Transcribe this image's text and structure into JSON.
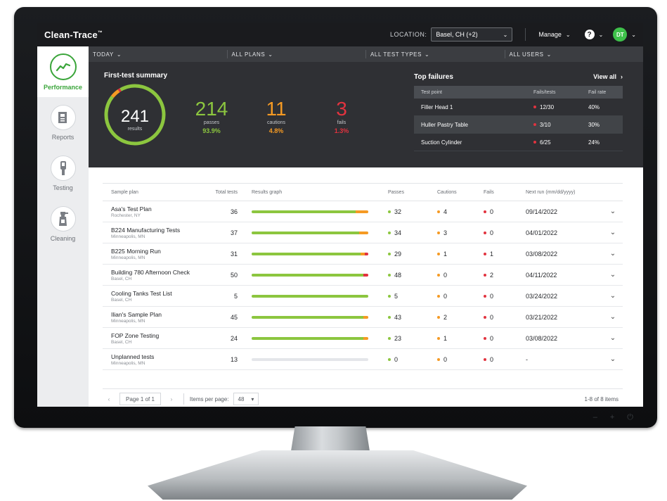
{
  "app": {
    "brand": "Clean-Trace",
    "brand_mark": "™"
  },
  "topbar": {
    "location_label": "LOCATION:",
    "location_value": "Basel, CH (+2)",
    "manage_label": "Manage",
    "help_glyph": "?",
    "user_initials": "DT"
  },
  "sidebar": {
    "items": [
      {
        "label": "Performance",
        "icon": "performance-chart-icon",
        "active": true
      },
      {
        "label": "Reports",
        "icon": "reports-icon",
        "active": false
      },
      {
        "label": "Testing",
        "icon": "luminometer-icon",
        "active": false
      },
      {
        "label": "Cleaning",
        "icon": "spray-bottle-icon",
        "active": false
      }
    ]
  },
  "filters": [
    "TODAY",
    "ALL PLANS",
    "ALL TEST TYPES",
    "ALL USERS"
  ],
  "summary": {
    "title": "First-test summary",
    "results_total": "241",
    "results_label": "results",
    "passes": {
      "value": "214",
      "label": "passes",
      "pct": "93.9%"
    },
    "cautions": {
      "value": "11",
      "label": "cautions",
      "pct": "4.8%"
    },
    "fails": {
      "value": "3",
      "label": "fails",
      "pct": "1.3%"
    },
    "ring_fractions": {
      "pass": 0.939,
      "caution": 0.048,
      "fail": 0.013
    }
  },
  "top_failures": {
    "title": "Top failures",
    "view_all": "View all",
    "headers": [
      "Test point",
      "Fails/tests",
      "Fail rate"
    ],
    "rows": [
      {
        "point": "Filler Head 1",
        "ratio": "12/30",
        "rate": "40%"
      },
      {
        "point": "Huller Pastry Table",
        "ratio": "3/10",
        "rate": "30%"
      },
      {
        "point": "Suction Cylinder",
        "ratio": "6/25",
        "rate": "24%"
      }
    ]
  },
  "table": {
    "headers": [
      "Sample plan",
      "Total tests",
      "Results graph",
      "Passes",
      "Cautions",
      "Fails",
      "Next run (mm/dd/yyyy)"
    ],
    "rows": [
      {
        "name": "Asa's Test Plan",
        "loc": "Rochester, NY",
        "total": "36",
        "passes": "32",
        "cautions": "4",
        "fails": "0",
        "next": "09/14/2022",
        "p": 32,
        "c": 4,
        "f": 0
      },
      {
        "name": "B224 Manufacturing Tests",
        "loc": "Minneapolis, MN",
        "total": "37",
        "passes": "34",
        "cautions": "3",
        "fails": "0",
        "next": "04/01/2022",
        "p": 34,
        "c": 3,
        "f": 0
      },
      {
        "name": "B225 Morning Run",
        "loc": "Minneapolis, MN",
        "total": "31",
        "passes": "29",
        "cautions": "1",
        "fails": "1",
        "next": "03/08/2022",
        "p": 29,
        "c": 1,
        "f": 1
      },
      {
        "name": "Building 780 Afternoon Check",
        "loc": "Basel, CH",
        "total": "50",
        "passes": "48",
        "cautions": "0",
        "fails": "2",
        "next": "04/11/2022",
        "p": 48,
        "c": 0,
        "f": 2
      },
      {
        "name": "Cooling Tanks Test List",
        "loc": "Basel, CH",
        "total": "5",
        "passes": "5",
        "cautions": "0",
        "fails": "0",
        "next": "03/24/2022",
        "p": 5,
        "c": 0,
        "f": 0
      },
      {
        "name": "Ilian's Sample Plan",
        "loc": "Minneapolis, MN",
        "total": "45",
        "passes": "43",
        "cautions": "2",
        "fails": "0",
        "next": "03/21/2022",
        "p": 43,
        "c": 2,
        "f": 0
      },
      {
        "name": "FOP Zone Testing",
        "loc": "Basel, CH",
        "total": "24",
        "passes": "23",
        "cautions": "1",
        "fails": "0",
        "next": "03/08/2022",
        "p": 23,
        "c": 1,
        "f": 0
      },
      {
        "name": "Unplanned tests",
        "loc": "Minneapolis, MN",
        "total": "13",
        "passes": "0",
        "cautions": "0",
        "fails": "0",
        "next": "-",
        "p": 0,
        "c": 0,
        "f": 0
      }
    ]
  },
  "pager": {
    "page_text": "Page 1 of 1",
    "items_per_page_label": "Items per page:",
    "items_per_page_value": "48",
    "range_text": "1-8 of 8 items"
  },
  "colors": {
    "pass": "#8cc63f",
    "caution": "#f59a23",
    "fail": "#e2333f",
    "brand_green": "#3aa53a",
    "avatar": "#3ec14a"
  }
}
